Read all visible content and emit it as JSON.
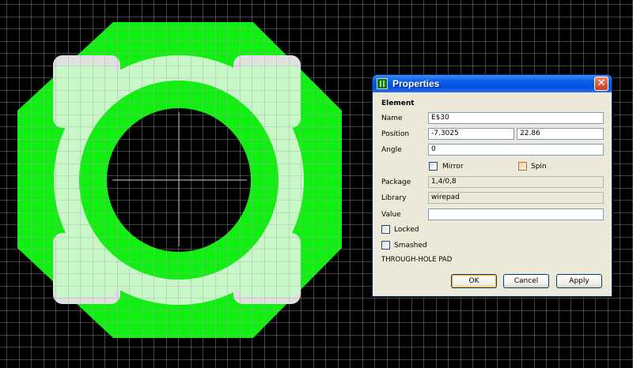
{
  "dialog": {
    "title": "Properties",
    "close_glyph": "✕",
    "section_label": "Element",
    "name_label": "Name",
    "name_value": "E$30",
    "position_label": "Position",
    "position_x": "-7.3025",
    "position_y": "22.86",
    "angle_label": "Angle",
    "angle_value": "0",
    "mirror_label": "Mirror",
    "mirror_checked": false,
    "spin_label": "Spin",
    "spin_checked": false,
    "package_label": "Package",
    "package_value": "1,4/0,8",
    "library_label": "Library",
    "library_value": "wirepad",
    "value_label": "Value",
    "value_value": "",
    "locked_label": "Locked",
    "locked_checked": false,
    "smashed_label": "Smashed",
    "smashed_checked": false,
    "object_type": "THROUGH-HOLE PAD",
    "ok_label": "OK",
    "cancel_label": "Cancel",
    "apply_label": "Apply"
  },
  "colors": {
    "background": "#000000",
    "grid": "#a8a8a8",
    "copper_pad": "#11ee11",
    "restrict_layer": "#c8f7c8",
    "tstop_corners": "#e0e0e0",
    "hole": "#000000",
    "crosshair": "#c0c0c0",
    "titlebar": "#0a5fe6",
    "dialog_face": "#ece9d8"
  },
  "icons": {
    "app": "eagle-app-icon",
    "close": "close-icon"
  }
}
